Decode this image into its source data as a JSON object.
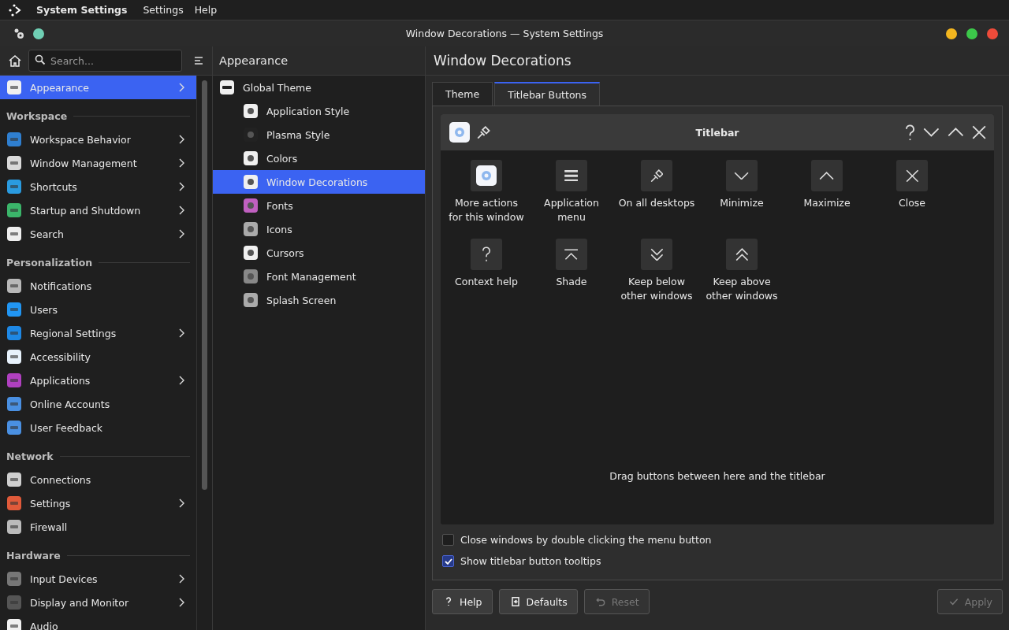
{
  "menubar": {
    "app_name": "System Settings",
    "menus": [
      "Settings",
      "Help"
    ]
  },
  "window": {
    "title": "Window Decorations — System Settings"
  },
  "sidebar": {
    "search": {
      "placeholder": "Search..."
    },
    "items": [
      {
        "kind": "item",
        "label": "Appearance",
        "selected": true,
        "has_children": true
      },
      {
        "kind": "header",
        "label": "Workspace"
      },
      {
        "kind": "item",
        "label": "Workspace Behavior",
        "selected": false,
        "has_children": true
      },
      {
        "kind": "item",
        "label": "Window Management",
        "selected": false,
        "has_children": true
      },
      {
        "kind": "item",
        "label": "Shortcuts",
        "selected": false,
        "has_children": true
      },
      {
        "kind": "item",
        "label": "Startup and Shutdown",
        "selected": false,
        "has_children": true
      },
      {
        "kind": "item",
        "label": "Search",
        "selected": false,
        "has_children": true
      },
      {
        "kind": "header",
        "label": "Personalization"
      },
      {
        "kind": "item",
        "label": "Notifications",
        "selected": false,
        "has_children": false
      },
      {
        "kind": "item",
        "label": "Users",
        "selected": false,
        "has_children": false
      },
      {
        "kind": "item",
        "label": "Regional Settings",
        "selected": false,
        "has_children": true
      },
      {
        "kind": "item",
        "label": "Accessibility",
        "selected": false,
        "has_children": false
      },
      {
        "kind": "item",
        "label": "Applications",
        "selected": false,
        "has_children": true
      },
      {
        "kind": "item",
        "label": "Online Accounts",
        "selected": false,
        "has_children": false
      },
      {
        "kind": "item",
        "label": "User Feedback",
        "selected": false,
        "has_children": false
      },
      {
        "kind": "header",
        "label": "Network"
      },
      {
        "kind": "item",
        "label": "Connections",
        "selected": false,
        "has_children": false
      },
      {
        "kind": "item",
        "label": "Settings",
        "selected": false,
        "has_children": true
      },
      {
        "kind": "item",
        "label": "Firewall",
        "selected": false,
        "has_children": false
      },
      {
        "kind": "header",
        "label": "Hardware"
      },
      {
        "kind": "item",
        "label": "Input Devices",
        "selected": false,
        "has_children": true
      },
      {
        "kind": "item",
        "label": "Display and Monitor",
        "selected": false,
        "has_children": true
      },
      {
        "kind": "item",
        "label": "Audio",
        "selected": false,
        "has_children": false
      }
    ]
  },
  "subpage": {
    "title": "Appearance",
    "items": [
      {
        "label": "Global Theme",
        "selected": false,
        "children": [
          {
            "label": "Application Style",
            "selected": false
          },
          {
            "label": "Plasma Style",
            "selected": false
          },
          {
            "label": "Colors",
            "selected": false
          },
          {
            "label": "Window Decorations",
            "selected": true
          },
          {
            "label": "Fonts",
            "selected": false
          },
          {
            "label": "Icons",
            "selected": false
          },
          {
            "label": "Cursors",
            "selected": false
          },
          {
            "label": "Font Management",
            "selected": false
          },
          {
            "label": "Splash Screen",
            "selected": false
          }
        ]
      }
    ]
  },
  "content": {
    "title": "Window Decorations",
    "tabs": [
      {
        "label": "Theme",
        "selected": false
      },
      {
        "label": "Titlebar Buttons",
        "selected": true
      }
    ],
    "titlebar": {
      "title": "Titlebar",
      "left_buttons": [
        {
          "kind": "menu"
        },
        {
          "kind": "pin"
        }
      ],
      "right_buttons": [
        {
          "kind": "help"
        },
        {
          "kind": "minimize"
        },
        {
          "kind": "maximize"
        },
        {
          "kind": "close"
        }
      ]
    },
    "available_buttons": [
      {
        "kind": "menu",
        "label": "More actions\nfor this window"
      },
      {
        "kind": "appmenu",
        "label": "Application\nmenu"
      },
      {
        "kind": "pin",
        "label": "On all desktops"
      },
      {
        "kind": "minimize",
        "label": "Minimize"
      },
      {
        "kind": "maximize",
        "label": "Maximize"
      },
      {
        "kind": "close",
        "label": "Close"
      },
      {
        "kind": "help",
        "label": "Context help"
      },
      {
        "kind": "shade",
        "label": "Shade"
      },
      {
        "kind": "below",
        "label": "Keep below\nother windows"
      },
      {
        "kind": "above",
        "label": "Keep above\nother windows"
      }
    ],
    "hint": "Drag buttons between here and the titlebar",
    "options": [
      {
        "label": "Close windows by double clicking the menu button",
        "checked": false
      },
      {
        "label": "Show titlebar button tooltips",
        "checked": true
      }
    ]
  },
  "footer": {
    "buttons": [
      {
        "kind": "help",
        "label": "Help",
        "disabled": false
      },
      {
        "kind": "defaults",
        "label": "Defaults",
        "disabled": false
      },
      {
        "kind": "reset",
        "label": "Reset",
        "disabled": true
      },
      {
        "kind": "apply",
        "label": "Apply",
        "disabled": true
      }
    ]
  }
}
